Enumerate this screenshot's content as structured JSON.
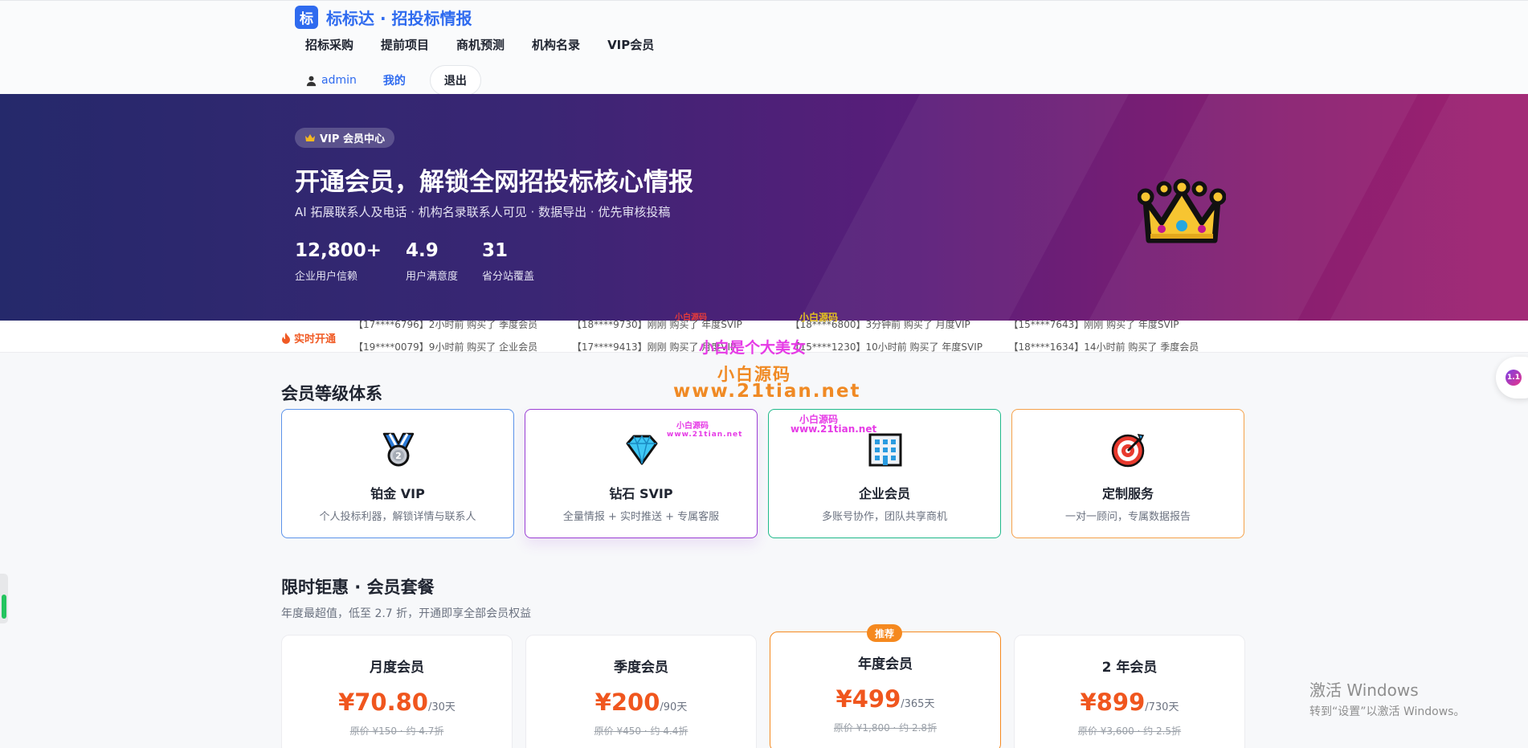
{
  "header": {
    "logo_char": "标",
    "brand_name": "标标达 · 招投标情报",
    "nav": [
      "招标采购",
      "提前项目",
      "商机预测",
      "机构名录",
      "VIP会员"
    ],
    "user_name": "admin",
    "mine_label": "我的",
    "logout_label": "退出"
  },
  "hero": {
    "badge": "VIP 会员中心",
    "title": "开通会员，解锁全网招投标核心情报",
    "subtitle": "AI 拓展联系人及电话 · 机构名录联系人可见 · 数据导出 · 优先审核投稿",
    "stats": [
      {
        "value": "12,800+",
        "label": "企业用户信赖"
      },
      {
        "value": "4.9",
        "label": "用户满意度"
      },
      {
        "value": "31",
        "label": "省分站覆盖"
      }
    ]
  },
  "ticker": {
    "label": "实时开通",
    "line1": [
      "【17****6796】2小时前 购买了 季度会员",
      "【18****9730】刚刚 购买了 年度SVIP",
      "【18****6800】3分钟前 购买了 月度VIP",
      "【15****7643】刚刚 购买了 年度SVIP"
    ],
    "line2": [
      "【19****0079】9小时前 购买了 企业会员",
      "【17****9413】刚刚 购买了 月度VIP",
      "【15****1230】10小时前 购买了 年度SVIP",
      "【18****1634】14小时前 购买了 季度会员"
    ]
  },
  "watermarks": [
    "小白是个大美女",
    "小白源码",
    "www.21tian.net",
    "小白源码",
    "小白源码",
    "小白源码",
    "www.21tian.net",
    "小白源码",
    "www.21tian.net"
  ],
  "tiers": {
    "title": "会员等级体系",
    "items": [
      {
        "name": "铂金 VIP",
        "desc": "个人投标利器，解锁详情与联系人",
        "icon": "medal-icon"
      },
      {
        "name": "钻石 SVIP",
        "desc": "全量情报 + 实时推送 + 专属客服",
        "icon": "diamond-icon"
      },
      {
        "name": "企业会员",
        "desc": "多账号协作，团队共享商机",
        "icon": "building-icon"
      },
      {
        "name": "定制服务",
        "desc": "一对一顾问，专属数据报告",
        "icon": "target-icon"
      }
    ]
  },
  "plans": {
    "title": "限时钜惠 · 会员套餐",
    "subtitle": "年度最超值，低至 2.7 折，开通即享全部会员权益",
    "hot_badge": "推荐",
    "items": [
      {
        "name": "月度会员",
        "price": "¥70.80",
        "period": "/30天",
        "original": "原价 ¥150 · 约 4.7折"
      },
      {
        "name": "季度会员",
        "price": "¥200",
        "period": "/90天",
        "original": "原价 ¥450 · 约 4.4折"
      },
      {
        "name": "年度会员",
        "price": "¥499",
        "period": "/365天",
        "original": "原价 ¥1,800 · 约 2.8折"
      },
      {
        "name": "2 年会员",
        "price": "¥899",
        "period": "/730天",
        "original": "原价 ¥3,600 · 约 2.5折"
      }
    ]
  },
  "windows_notice": {
    "line1": "激活 Windows",
    "line2": "转到“设置”以激活 Windows。"
  },
  "side_widget": {
    "badge": "1.1"
  },
  "colors": {
    "brand": "#2f6bef",
    "accent": "#f0561e",
    "hot": "#f5891f"
  }
}
